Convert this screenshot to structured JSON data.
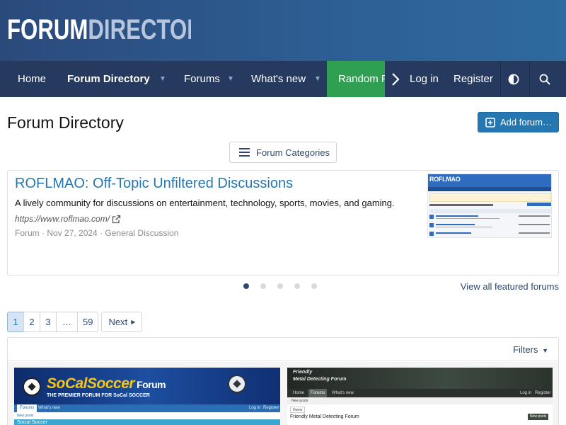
{
  "header": {
    "logo_part1": "FORUM",
    "logo_part2": "DIRECTORY"
  },
  "nav": {
    "home": "Home",
    "forum_directory": "Forum Directory",
    "forums": "Forums",
    "whats_new": "What's new",
    "random": "Random F",
    "login": "Log in",
    "register": "Register"
  },
  "page": {
    "title": "Forum Directory",
    "add_button": "Add forum…",
    "categories_button": "Forum Categories"
  },
  "featured": {
    "title": "ROFLMAO: Off-Topic Unfiltered Discussions",
    "description": "A lively community for discussions on entertainment, technology, sports, movies, and gaming.",
    "url": "https://www.roflmao.com/",
    "type": "Forum",
    "date": "Nov 27, 2024",
    "category": "General Discussion",
    "thumb_logo": "ROFLMAO",
    "slides": 5,
    "active_slide": 1,
    "view_all": "View all featured forums"
  },
  "pagination": {
    "pages": [
      "1",
      "2",
      "3",
      "…",
      "59"
    ],
    "current": "1",
    "next": "Next"
  },
  "list": {
    "filters": "Filters",
    "card1": {
      "name": "SoCalSoccer",
      "suffix": "Forum",
      "tagline": "THE PREMIER FORUM FOR SoCal SOCCER",
      "tab1": "Forums",
      "tab2": "What's new",
      "login": "Log in",
      "register": "Register",
      "sub": "New posts",
      "board": "Social Soccer"
    },
    "card2": {
      "line1": "Friendly",
      "line2": "Metal Detecting Forum",
      "tab_home": "Home",
      "tab_forums": "Forums",
      "tab_new": "What's new",
      "login": "Log in",
      "register": "Register",
      "sub": "New posts",
      "crumb": "Home",
      "board": "Friendly Metal Detecting Forum",
      "new_posts_btn": "New posts"
    }
  },
  "colors": {
    "header_bg": "#2d5f94",
    "nav_bg": "#253a5e",
    "accent": "#2577b1",
    "random_bg": "#2f9f52"
  }
}
